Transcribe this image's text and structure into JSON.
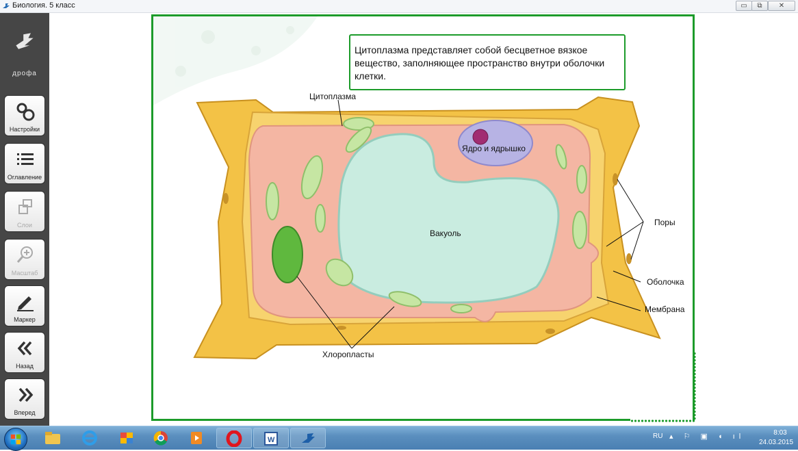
{
  "window": {
    "title": "Биология. 5 класс",
    "controls": [
      "minimize-icon",
      "restore-icon",
      "close-icon"
    ]
  },
  "sidebar": {
    "logo": "дрофа",
    "buttons": [
      {
        "label": "Настройки",
        "icon": "gears-icon",
        "enabled": true
      },
      {
        "label": "Оглавление",
        "icon": "list-icon",
        "enabled": true
      },
      {
        "label": "Слои",
        "icon": "layers-icon",
        "enabled": false
      },
      {
        "label": "Масштаб",
        "icon": "zoom-icon",
        "enabled": false
      },
      {
        "label": "Маркер",
        "icon": "pen-icon",
        "enabled": true
      },
      {
        "label": "Назад",
        "icon": "double-left-icon",
        "enabled": true
      },
      {
        "label": "Вперед",
        "icon": "double-right-icon",
        "enabled": true
      }
    ]
  },
  "callout": {
    "text": "Цитоплазма представляет собой бесцветное вязкое вещество, заполняющее пространство внутри оболочки клетки."
  },
  "diagram": {
    "labels": {
      "cytoplasm": "Цитоплазма",
      "nucleus": "Ядро и ядрышко",
      "vacuole": "Вакуоль",
      "pores": "Поры",
      "wall": "Оболочка",
      "membrane": "Мембрана",
      "chloroplasts": "Хлоропласты"
    }
  },
  "taskbar": {
    "apps": [
      "windows-start-icon",
      "explorer-icon",
      "ie-icon",
      "paint-icon",
      "chrome-icon",
      "media-icon",
      "opera-icon",
      "word-icon",
      "drofa-icon"
    ],
    "tray": {
      "language": "RU",
      "time": "8:03",
      "date": "24.03.2015"
    }
  },
  "colors": {
    "accent": "#1c9b2a",
    "cell_wall": "#f3c246",
    "cytoplasm": "#f4b6a3",
    "vacuole": "#c9ece0",
    "nucleus": "#b7b3e4"
  }
}
